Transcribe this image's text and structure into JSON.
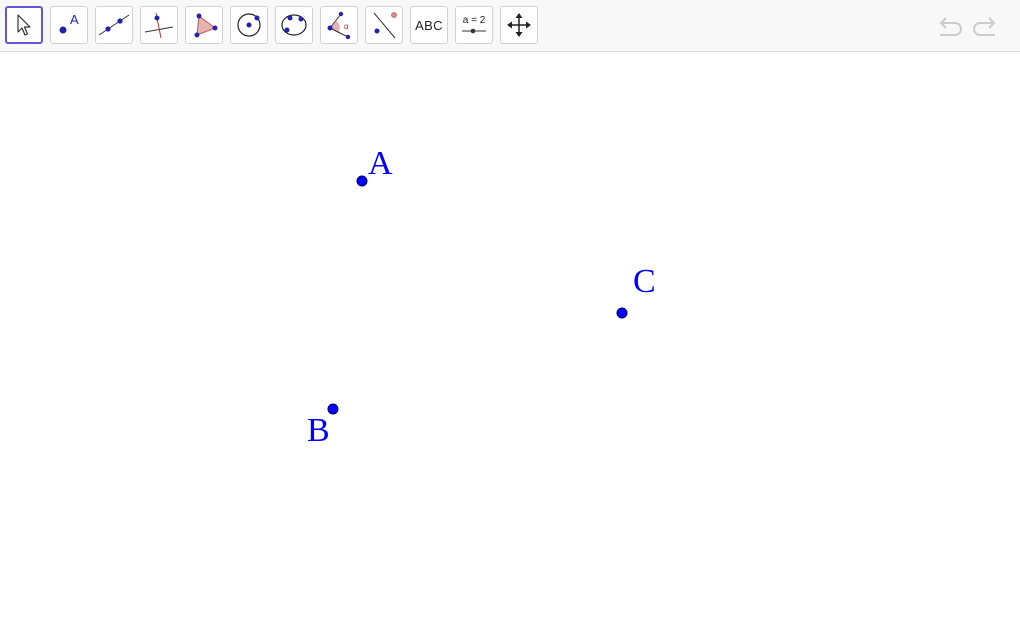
{
  "toolbar": {
    "tools": [
      {
        "id": "move",
        "icon": "move-cursor-icon",
        "selected": true
      },
      {
        "id": "point",
        "icon": "point-icon",
        "label": "A"
      },
      {
        "id": "line",
        "icon": "line-icon"
      },
      {
        "id": "perpendicular",
        "icon": "perpendicular-line-icon"
      },
      {
        "id": "polygon",
        "icon": "polygon-icon"
      },
      {
        "id": "circle",
        "icon": "circle-center-point-icon"
      },
      {
        "id": "conic",
        "icon": "conic-five-points-icon"
      },
      {
        "id": "angle",
        "icon": "angle-icon"
      },
      {
        "id": "reflect",
        "icon": "reflect-about-line-icon"
      },
      {
        "id": "text",
        "icon": "text-icon",
        "label": "ABC"
      },
      {
        "id": "slider",
        "icon": "slider-icon",
        "label": "a = 2"
      },
      {
        "id": "move-view",
        "icon": "move-graphics-view-icon"
      }
    ],
    "undo_icon": "undo-icon",
    "redo_icon": "redo-icon"
  },
  "colors": {
    "point": "#0000ff",
    "point_stroke": "#000066",
    "label": "#0000ff",
    "selected_border": "#6557d2",
    "disabled_icon": "#cccccc"
  },
  "points": [
    {
      "name": "A",
      "label": "A"
    },
    {
      "name": "B",
      "label": "B"
    },
    {
      "name": "C",
      "label": "C"
    }
  ]
}
